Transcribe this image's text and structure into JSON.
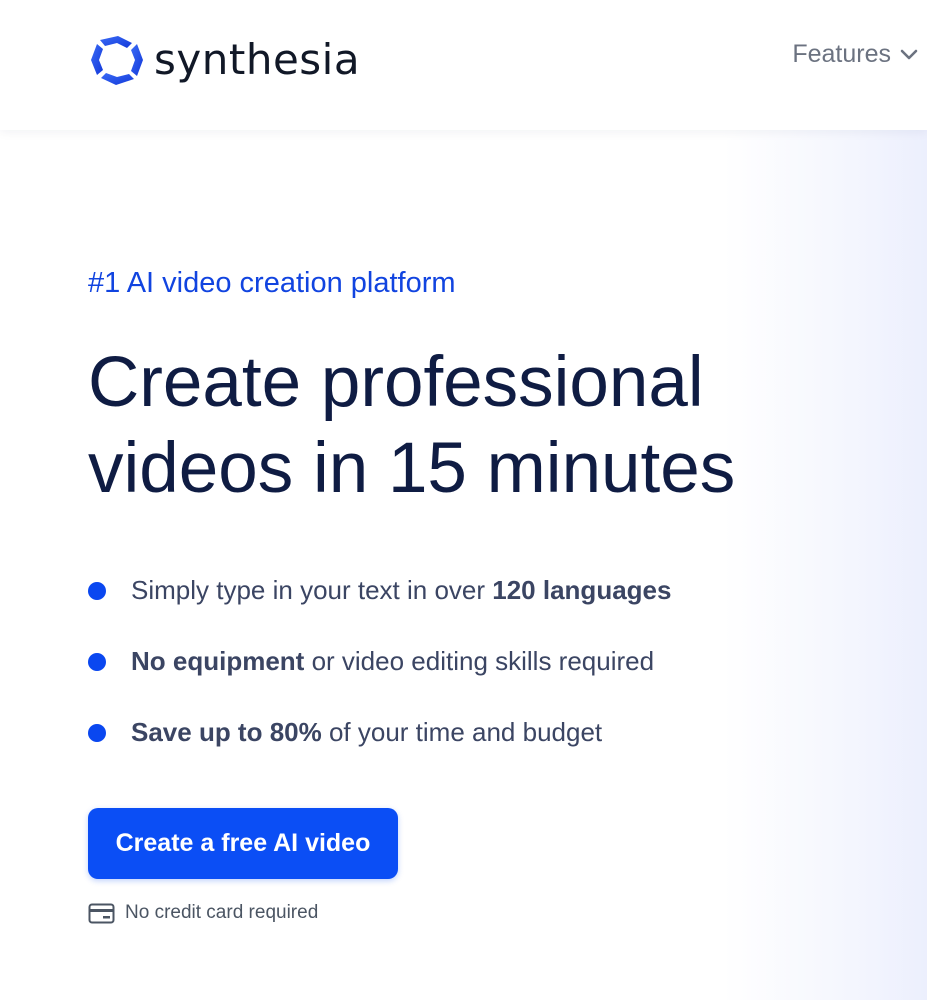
{
  "header": {
    "brand": "synthesia",
    "nav_features": "Features"
  },
  "hero": {
    "eyebrow": "#1 AI video creation platform",
    "headline_line1": "Create professional",
    "headline_line2": "videos in 15 minutes",
    "features": [
      {
        "pre": "Simply type in your text in over ",
        "bold": "120 languages",
        "post": ""
      },
      {
        "pre": "",
        "bold": "No equipment",
        "post": " or video editing skills required"
      },
      {
        "pre": "",
        "bold": "Save up to 80%",
        "post": " of your time and budget"
      }
    ],
    "cta_label": "Create a free AI video",
    "note": "No credit card required"
  },
  "colors": {
    "accent": "#0b4ef5",
    "eyebrow": "#1144e0",
    "headline": "#0f1c43",
    "body_text": "#3b4563"
  },
  "icons": {
    "logo": "synthesia-logo-icon",
    "nav_chevron": "chevron-down-icon",
    "note": "credit-card-icon"
  }
}
